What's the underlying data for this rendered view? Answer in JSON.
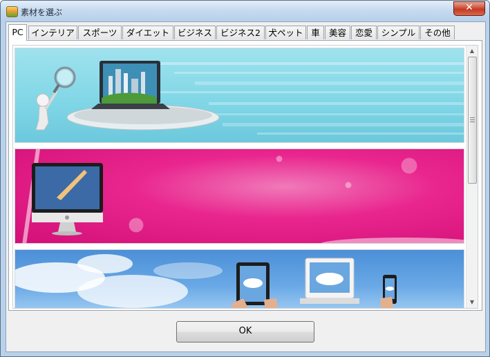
{
  "window": {
    "title": "素材を選ぶ",
    "close_label": "✕"
  },
  "tabs": [
    {
      "label": "PC",
      "active": true
    },
    {
      "label": "インテリア",
      "active": false
    },
    {
      "label": "スポーツ",
      "active": false
    },
    {
      "label": "ダイエット",
      "active": false
    },
    {
      "label": "ビジネス",
      "active": false
    },
    {
      "label": "ビジネス2",
      "active": false
    },
    {
      "label": "犬ペット",
      "active": false
    },
    {
      "label": "車",
      "active": false
    },
    {
      "label": "美容",
      "active": false
    },
    {
      "label": "恋愛",
      "active": false
    },
    {
      "label": "シンプル",
      "active": false
    },
    {
      "label": "その他",
      "active": false
    }
  ],
  "banners": [
    {
      "id": "banner-pc-laptop"
    },
    {
      "id": "banner-pink-imac"
    },
    {
      "id": "banner-sky-devices"
    }
  ],
  "colors": {
    "banner_pc_bg": "#8fdbe9",
    "banner_pink_bg": "#e51f8a",
    "banner_sky_bg": "#5c9fe0"
  },
  "buttons": {
    "ok_label": "OK"
  }
}
